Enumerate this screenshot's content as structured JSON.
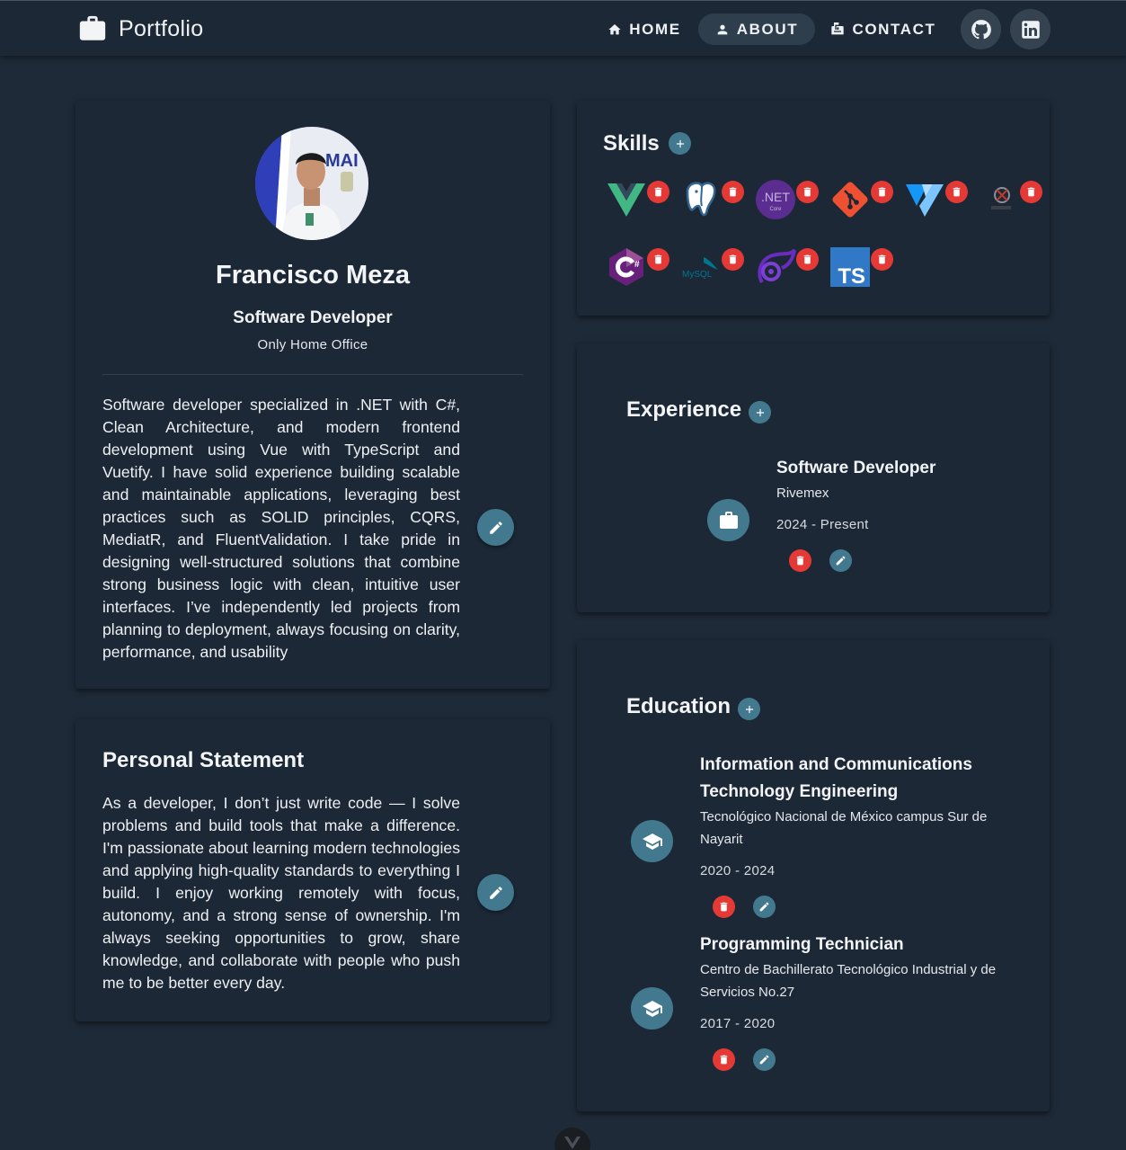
{
  "app": {
    "title": "Portfolio"
  },
  "nav": {
    "items": [
      {
        "label": "HOME",
        "icon": "home-icon",
        "active": false
      },
      {
        "label": "ABOUT",
        "icon": "account-icon",
        "active": true
      },
      {
        "label": "CONTACT",
        "icon": "mailbox-icon",
        "active": false
      }
    ],
    "social": [
      "github-icon",
      "linkedin-icon"
    ]
  },
  "profile": {
    "name": "Francisco Meza",
    "role": "Software Developer",
    "work_mode": "Only Home Office",
    "bio": "Software developer specialized in .NET with C#, Clean Architecture, and modern frontend development using Vue with TypeScript and Vuetify. I have solid experience building scalable and maintainable applications, leveraging best practices such as SOLID principles, CQRS, MediatR, and FluentValidation. I take pride in designing well-structured solutions that combine strong business logic with clean, intuitive user interfaces. I’ve independently led projects from planning to deployment, always focusing on clarity, performance, and usability"
  },
  "statement": {
    "title": "Personal Statement",
    "text": "As a developer, I don’t just write code — I solve problems and build tools that make a difference. I'm passionate about learning modern technologies and applying high-quality standards to everything I build. I enjoy working remotely with focus, autonomy, and a strong sense of ownership. I'm always seeking opportunities to grow, share knowledge, and collaborate with people who push me to be better every day."
  },
  "skills": {
    "title": "Skills",
    "items": [
      {
        "icon": "vue-icon"
      },
      {
        "icon": "postgresql-icon"
      },
      {
        "icon": "dotnet-core-icon",
        "label": ".NET",
        "sublabel": "Core"
      },
      {
        "icon": "git-icon"
      },
      {
        "icon": "vuetify-icon"
      },
      {
        "icon": "unity-icon"
      },
      {
        "icon": "csharp-icon"
      },
      {
        "icon": "mysql-icon",
        "label": "MySQL"
      },
      {
        "icon": "blazor-icon"
      },
      {
        "icon": "typescript-icon",
        "label": "TS"
      }
    ]
  },
  "experience": {
    "title": "Experience",
    "items": [
      {
        "title": "Software Developer",
        "company": "Rivemex",
        "period": "2024 - Present"
      }
    ]
  },
  "education": {
    "title": "Education",
    "items": [
      {
        "title_line1": "Information and Communications",
        "title_line2": "Technology Engineering",
        "school_line1": "Tecnológico Nacional de México campus Sur de",
        "school_line2": "Nayarit",
        "period": "2020 - 2024"
      },
      {
        "title_line1": "Programming Technician",
        "school_line1": "Centro de Bachillerato Tecnológico Industrial y de",
        "school_line2": "Servicios No.27",
        "period": "2017 - 2020"
      }
    ]
  },
  "colors": {
    "background": "#1e2a38",
    "card": "#1c2836",
    "accent": "#43798e",
    "danger": "#e53935"
  }
}
